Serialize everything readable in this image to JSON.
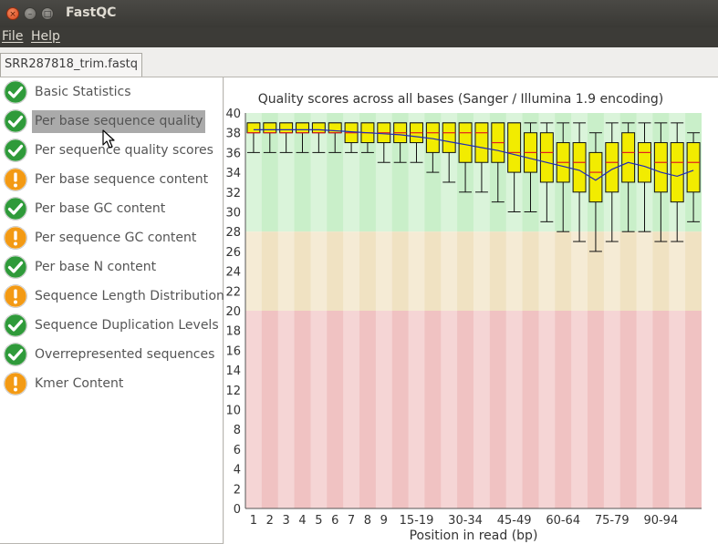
{
  "window": {
    "title": "FastQC",
    "close_glyph": "×",
    "min_glyph": "–",
    "max_glyph": "□"
  },
  "menu": [
    {
      "label": "File"
    },
    {
      "label": "Help"
    }
  ],
  "tab": {
    "label": "SRR287818_trim.fastq"
  },
  "modules": [
    {
      "label": "Basic Statistics",
      "status": "pass",
      "icon": "check-icon"
    },
    {
      "label": "Per base sequence quality",
      "status": "pass",
      "icon": "check-icon",
      "selected": true
    },
    {
      "label": "Per sequence quality scores",
      "status": "pass",
      "icon": "check-icon"
    },
    {
      "label": "Per base sequence content",
      "status": "warn",
      "icon": "warning-icon"
    },
    {
      "label": "Per base GC content",
      "status": "pass",
      "icon": "check-icon"
    },
    {
      "label": "Per sequence GC content",
      "status": "warn",
      "icon": "warning-icon"
    },
    {
      "label": "Per base N content",
      "status": "pass",
      "icon": "check-icon"
    },
    {
      "label": "Sequence Length Distribution",
      "status": "warn",
      "icon": "warning-icon"
    },
    {
      "label": "Sequence Duplication Levels",
      "status": "pass",
      "icon": "check-icon"
    },
    {
      "label": "Overrepresented sequences",
      "status": "pass",
      "icon": "check-icon"
    },
    {
      "label": "Kmer Content",
      "status": "warn",
      "icon": "warning-icon"
    }
  ],
  "colors": {
    "pass": "#2f9a3a",
    "warn": "#f39a14",
    "box": "#f2ec00",
    "median": "#e02020",
    "mean": "#1f2bb8",
    "zone_good": "#c9efc9",
    "zone_ok": "#f0e2c2",
    "zone_bad": "#f0c2c2"
  },
  "chart_data": {
    "type": "boxplot",
    "title": "Quality scores across all bases (Sanger / Illumina 1.9 encoding)",
    "xlabel": "Position in read (bp)",
    "ylabel": "",
    "ylim": [
      0,
      40
    ],
    "yticks": [
      0,
      2,
      4,
      6,
      8,
      10,
      12,
      14,
      16,
      18,
      20,
      22,
      24,
      26,
      28,
      30,
      32,
      34,
      36,
      38,
      40
    ],
    "quality_zones": [
      {
        "name": "good",
        "from": 28,
        "to": 40
      },
      {
        "name": "reasonable",
        "from": 20,
        "to": 28
      },
      {
        "name": "poor",
        "from": 0,
        "to": 20
      }
    ],
    "categories": [
      "1",
      "2",
      "3",
      "4",
      "5",
      "6",
      "7",
      "8",
      "9",
      "10-14",
      "15-19",
      "20-24",
      "25-29",
      "30-34",
      "35-39",
      "40-44",
      "45-49",
      "50-54",
      "55-59",
      "60-64",
      "65-69",
      "70-74",
      "75-79",
      "80-84",
      "85-89",
      "90-94",
      "95-99",
      "100-101"
    ],
    "visible_tick_labels": [
      "1",
      "2",
      "3",
      "4",
      "5",
      "6",
      "7",
      "8",
      "9",
      "15-19",
      "30-34",
      "45-49",
      "60-64",
      "75-79",
      "90-94"
    ],
    "boxes": [
      {
        "whisker_low": 36,
        "q1": 38,
        "median": 38,
        "q3": 39,
        "whisker_high": 39,
        "mean": 38.3
      },
      {
        "whisker_low": 36,
        "q1": 38,
        "median": 38,
        "q3": 39,
        "whisker_high": 39,
        "mean": 38.3
      },
      {
        "whisker_low": 36,
        "q1": 38,
        "median": 38,
        "q3": 39,
        "whisker_high": 39,
        "mean": 38.3
      },
      {
        "whisker_low": 36,
        "q1": 38,
        "median": 38,
        "q3": 39,
        "whisker_high": 39,
        "mean": 38.3
      },
      {
        "whisker_low": 36,
        "q1": 38,
        "median": 38,
        "q3": 39,
        "whisker_high": 39,
        "mean": 38.3
      },
      {
        "whisker_low": 36,
        "q1": 38,
        "median": 38,
        "q3": 39,
        "whisker_high": 39,
        "mean": 38.2
      },
      {
        "whisker_low": 36,
        "q1": 37,
        "median": 38,
        "q3": 39,
        "whisker_high": 39,
        "mean": 38.1
      },
      {
        "whisker_low": 36,
        "q1": 37,
        "median": 38,
        "q3": 39,
        "whisker_high": 39,
        "mean": 38.0
      },
      {
        "whisker_low": 35,
        "q1": 37,
        "median": 38,
        "q3": 39,
        "whisker_high": 39,
        "mean": 37.9
      },
      {
        "whisker_low": 35,
        "q1": 37,
        "median": 38,
        "q3": 39,
        "whisker_high": 39,
        "mean": 37.8
      },
      {
        "whisker_low": 35,
        "q1": 37,
        "median": 38,
        "q3": 39,
        "whisker_high": 39,
        "mean": 37.6
      },
      {
        "whisker_low": 34,
        "q1": 36,
        "median": 38,
        "q3": 39,
        "whisker_high": 39,
        "mean": 37.4
      },
      {
        "whisker_low": 33,
        "q1": 36,
        "median": 38,
        "q3": 39,
        "whisker_high": 39,
        "mean": 37.1
      },
      {
        "whisker_low": 32,
        "q1": 35,
        "median": 38,
        "q3": 39,
        "whisker_high": 39,
        "mean": 36.8
      },
      {
        "whisker_low": 32,
        "q1": 35,
        "median": 38,
        "q3": 39,
        "whisker_high": 39,
        "mean": 36.5
      },
      {
        "whisker_low": 31,
        "q1": 35,
        "median": 37,
        "q3": 39,
        "whisker_high": 39,
        "mean": 36.2
      },
      {
        "whisker_low": 30,
        "q1": 34,
        "median": 36,
        "q3": 39,
        "whisker_high": 39,
        "mean": 35.8
      },
      {
        "whisker_low": 30,
        "q1": 34,
        "median": 36,
        "q3": 38,
        "whisker_high": 39,
        "mean": 35.4
      },
      {
        "whisker_low": 29,
        "q1": 33,
        "median": 36,
        "q3": 38,
        "whisker_high": 39,
        "mean": 35.0
      },
      {
        "whisker_low": 28,
        "q1": 33,
        "median": 35,
        "q3": 37,
        "whisker_high": 39,
        "mean": 34.6
      },
      {
        "whisker_low": 27,
        "q1": 32,
        "median": 35,
        "q3": 37,
        "whisker_high": 39,
        "mean": 34.2
      },
      {
        "whisker_low": 26,
        "q1": 31,
        "median": 34,
        "q3": 36,
        "whisker_high": 38,
        "mean": 33.2
      },
      {
        "whisker_low": 27,
        "q1": 32,
        "median": 35,
        "q3": 37,
        "whisker_high": 39,
        "mean": 34.3
      },
      {
        "whisker_low": 28,
        "q1": 33,
        "median": 36,
        "q3": 38,
        "whisker_high": 39,
        "mean": 35.0
      },
      {
        "whisker_low": 28,
        "q1": 33,
        "median": 36,
        "q3": 37,
        "whisker_high": 39,
        "mean": 34.6
      },
      {
        "whisker_low": 27,
        "q1": 32,
        "median": 35,
        "q3": 37,
        "whisker_high": 39,
        "mean": 34.0
      },
      {
        "whisker_low": 27,
        "q1": 31,
        "median": 35,
        "q3": 37,
        "whisker_high": 39,
        "mean": 33.6
      },
      {
        "whisker_low": 29,
        "q1": 32,
        "median": 35,
        "q3": 37,
        "whisker_high": 38,
        "mean": 34.2
      }
    ]
  }
}
